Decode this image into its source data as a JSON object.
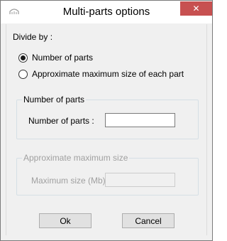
{
  "window": {
    "title": "Multi-parts options",
    "close_glyph": "✕",
    "icon": "app-icon"
  },
  "divide": {
    "label": "Divide by :",
    "options": [
      {
        "label": "Number of parts",
        "checked": true
      },
      {
        "label": "Approximate maximum size of each part",
        "checked": false
      }
    ]
  },
  "parts_group": {
    "title": "Number of parts",
    "field_label": "Number of parts :",
    "value": ""
  },
  "size_group": {
    "title": "Approximate maximum size",
    "field_label": "Maximum size (Mb) :",
    "value": "",
    "disabled": true
  },
  "buttons": {
    "ok_label": "Ok",
    "cancel_label": "Cancel"
  }
}
